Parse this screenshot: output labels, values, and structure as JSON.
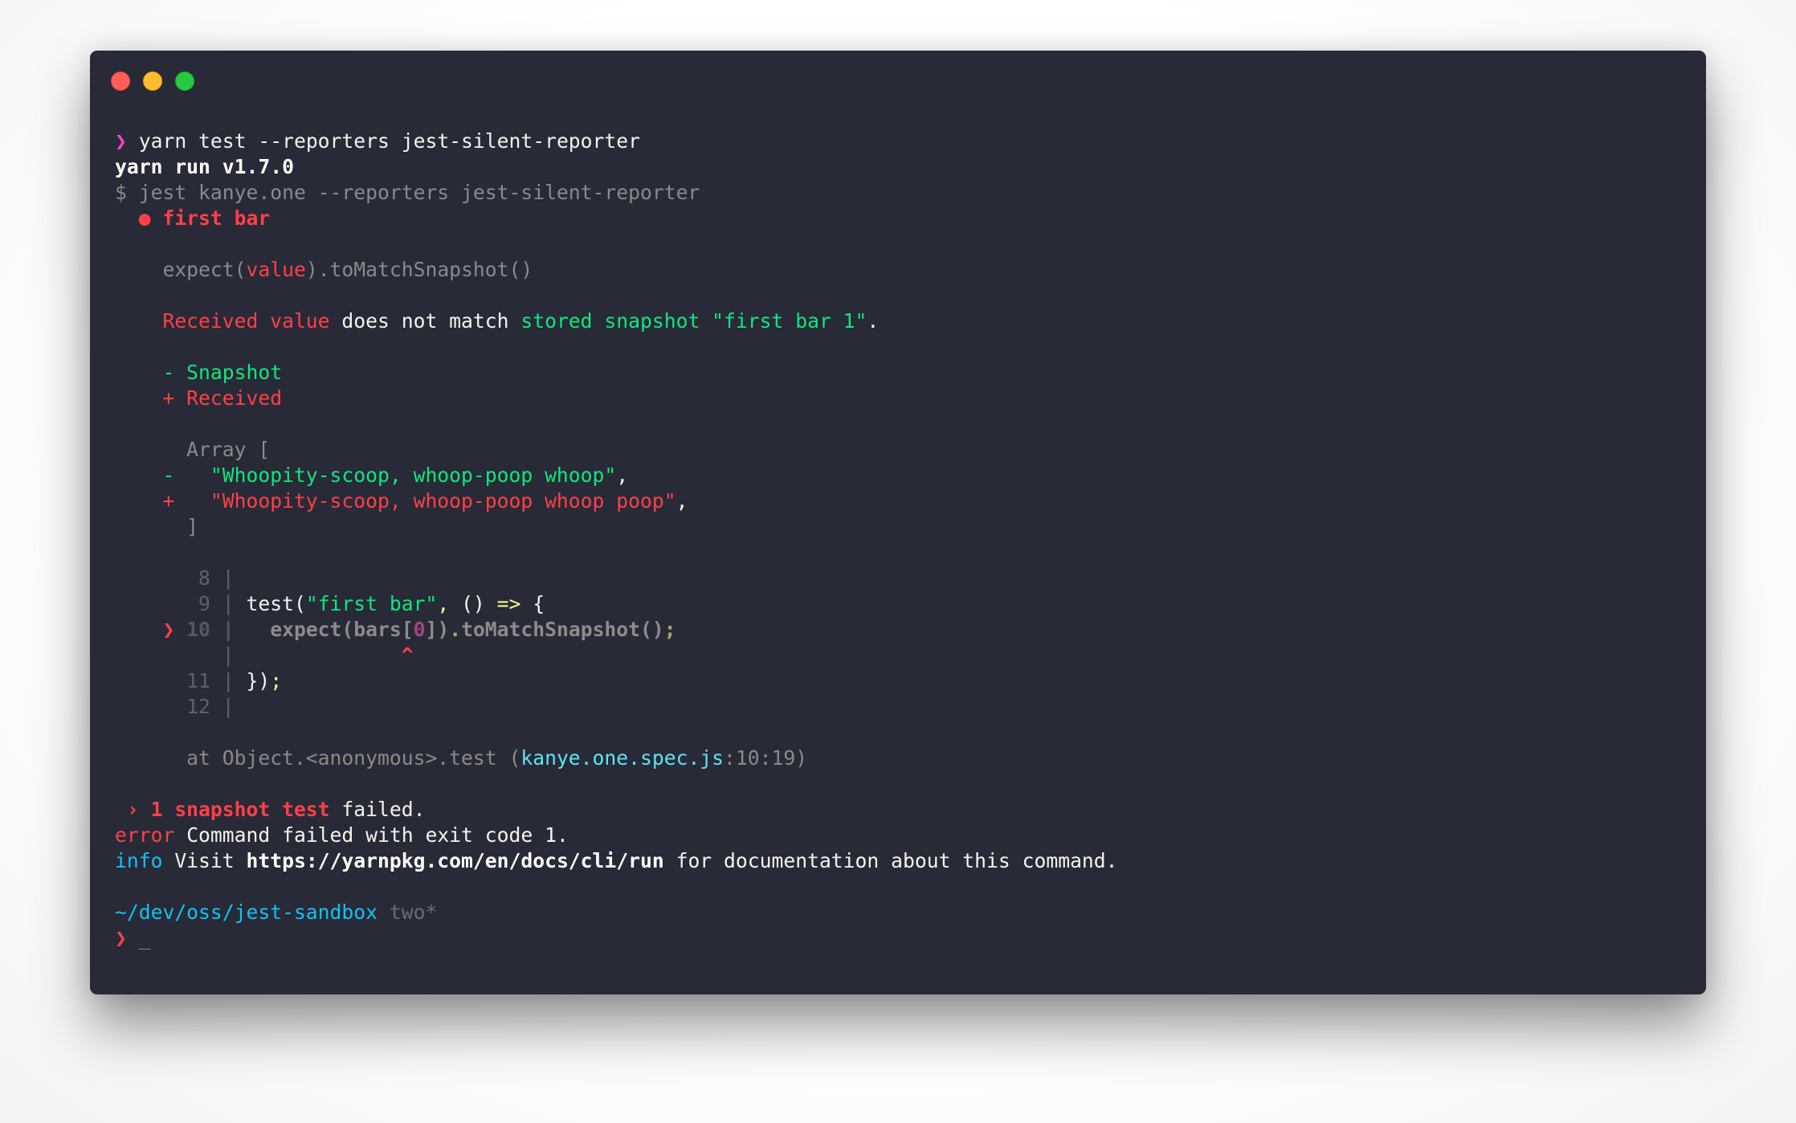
{
  "window": {
    "title": "",
    "traffic_lights": {
      "close_color": "#ff5f57",
      "minimize_color": "#febc2e",
      "maximize_color": "#28c840"
    },
    "background_color": "#282a37"
  },
  "terminal": {
    "lines": [
      {
        "name": "command-line",
        "segments": [
          {
            "text": "❯",
            "cls": "c-pink",
            "name": "prompt-icon"
          },
          {
            "text": " yarn test --reporters jest-silent-reporter",
            "cls": "c-fg",
            "name": "command-text"
          }
        ]
      },
      {
        "name": "yarn-version-line",
        "segments": [
          {
            "text": "yarn run v1.7.0",
            "cls": "c-fgb",
            "name": "yarn-version"
          }
        ]
      },
      {
        "name": "jest-command-line",
        "segments": [
          {
            "text": "$ jest kanye.one --reporters jest-silent-reporter",
            "cls": "c-dim",
            "name": "jest-command"
          }
        ]
      },
      {
        "name": "test-title-line",
        "segments": [
          {
            "text": "  ● first bar",
            "cls": "c-redb",
            "name": "failed-test-title"
          }
        ]
      },
      {
        "name": "blank-line",
        "segments": []
      },
      {
        "name": "matcher-hint-line",
        "segments": [
          {
            "text": "    expect(",
            "cls": "c-dim",
            "name": "matcher-hint"
          },
          {
            "text": "value",
            "cls": "c-red",
            "name": "matcher-hint-received"
          },
          {
            "text": ").toMatchSnapshot()",
            "cls": "c-dim",
            "name": "matcher-hint"
          }
        ]
      },
      {
        "name": "blank-line",
        "segments": []
      },
      {
        "name": "snapshot-message-line",
        "segments": [
          {
            "text": "    Received value",
            "cls": "c-red",
            "name": "received-value-label"
          },
          {
            "text": " does not match ",
            "cls": "c-white",
            "name": "message-text"
          },
          {
            "text": "stored snapshot \"first bar 1\"",
            "cls": "c-green",
            "name": "stored-snapshot-label"
          },
          {
            "text": ".",
            "cls": "c-white",
            "name": "message-text"
          }
        ]
      },
      {
        "name": "blank-line",
        "segments": []
      },
      {
        "name": "diff-legend-snapshot",
        "segments": [
          {
            "text": "    - Snapshot",
            "cls": "c-green",
            "name": "diff-legend-snapshot-label"
          }
        ]
      },
      {
        "name": "diff-legend-received",
        "segments": [
          {
            "text": "    + Received",
            "cls": "c-red",
            "name": "diff-legend-received-label"
          }
        ]
      },
      {
        "name": "blank-line",
        "segments": []
      },
      {
        "name": "diff-array-open",
        "segments": [
          {
            "text": "      Array [",
            "cls": "c-dim",
            "name": "diff-context"
          }
        ]
      },
      {
        "name": "diff-removed-line",
        "segments": [
          {
            "text": "    -   \"Whoopity-scoop, whoop-poop whoop\"",
            "cls": "c-green",
            "name": "diff-removed-value"
          },
          {
            "text": ",",
            "cls": "c-white",
            "name": "diff-punctuation"
          }
        ]
      },
      {
        "name": "diff-added-line",
        "segments": [
          {
            "text": "    +   \"Whoopity-scoop, whoop-poop whoop poop\"",
            "cls": "c-red",
            "name": "diff-added-value"
          },
          {
            "text": ",",
            "cls": "c-white",
            "name": "diff-punctuation"
          }
        ]
      },
      {
        "name": "diff-array-close",
        "segments": [
          {
            "text": "      ]",
            "cls": "c-dim",
            "name": "diff-context"
          }
        ]
      },
      {
        "name": "blank-line",
        "segments": []
      },
      {
        "name": "code-frame-line-8",
        "segments": [
          {
            "text": "       8 |",
            "cls": "c-dark",
            "name": "line-number-gutter"
          }
        ]
      },
      {
        "name": "code-frame-line-9",
        "segments": [
          {
            "text": "       9 |",
            "cls": "c-dark",
            "name": "line-number-gutter"
          },
          {
            "text": " test(",
            "cls": "c-white",
            "name": "code-text"
          },
          {
            "text": "\"first bar\"",
            "cls": "c-green",
            "name": "code-string"
          },
          {
            "text": ",",
            "cls": "c-yellow",
            "name": "code-punctuation"
          },
          {
            "text": " () ",
            "cls": "c-white",
            "name": "code-text"
          },
          {
            "text": "=>",
            "cls": "c-yellow",
            "name": "code-arrow"
          },
          {
            "text": " {",
            "cls": "c-white",
            "name": "code-text"
          }
        ]
      },
      {
        "name": "code-frame-line-10",
        "segments": [
          {
            "text": "    ❯ ",
            "cls": "c-redb",
            "name": "error-line-marker-icon"
          },
          {
            "text": "10 |",
            "cls": "c-darkb",
            "name": "line-number-gutter"
          },
          {
            "text": "   expect(bars[",
            "cls": "c-dimb",
            "name": "code-text"
          },
          {
            "text": "0",
            "cls": "c-purple",
            "name": "code-number"
          },
          {
            "text": "])",
            "cls": "c-dimb",
            "name": "code-text"
          },
          {
            "text": ".",
            "cls": "c-yellowd",
            "name": "code-punctuation"
          },
          {
            "text": "toMatchSnapshot()",
            "cls": "c-dimb",
            "name": "code-text"
          },
          {
            "text": ";",
            "cls": "c-yellowd",
            "name": "code-punctuation"
          }
        ]
      },
      {
        "name": "code-frame-caret-line",
        "segments": [
          {
            "text": "         |",
            "cls": "c-dark",
            "name": "line-number-gutter"
          },
          {
            "text": "              ",
            "cls": "c-white",
            "name": "spacer"
          },
          {
            "text": "^",
            "cls": "c-redb",
            "name": "error-caret"
          }
        ]
      },
      {
        "name": "code-frame-line-11",
        "segments": [
          {
            "text": "      11 |",
            "cls": "c-dark",
            "name": "line-number-gutter"
          },
          {
            "text": " })",
            "cls": "c-white",
            "name": "code-text"
          },
          {
            "text": ";",
            "cls": "c-yellow",
            "name": "code-punctuation"
          }
        ]
      },
      {
        "name": "code-frame-line-12",
        "segments": [
          {
            "text": "      12 |",
            "cls": "c-dark",
            "name": "line-number-gutter"
          }
        ]
      },
      {
        "name": "blank-line",
        "segments": []
      },
      {
        "name": "stack-trace-line",
        "segments": [
          {
            "text": "      at Object.<anonymous>.test (",
            "cls": "c-dim",
            "name": "stack-trace-text"
          },
          {
            "text": "kanye.one.spec.js",
            "cls": "c-cyanl",
            "name": "stack-trace-file-link"
          },
          {
            "text": ":10:19)",
            "cls": "c-dim",
            "name": "stack-trace-location"
          }
        ]
      },
      {
        "name": "blank-line",
        "segments": []
      },
      {
        "name": "summary-line",
        "segments": [
          {
            "text": " › 1 snapshot test",
            "cls": "c-redb",
            "name": "summary-failed-count"
          },
          {
            "text": " failed.",
            "cls": "c-white",
            "name": "summary-text"
          }
        ]
      },
      {
        "name": "yarn-error-line",
        "segments": [
          {
            "text": "error",
            "cls": "c-red",
            "name": "error-label"
          },
          {
            "text": " Command failed with exit code 1.",
            "cls": "c-white",
            "name": "error-message"
          }
        ]
      },
      {
        "name": "yarn-info-line",
        "segments": [
          {
            "text": "info",
            "cls": "c-cyan",
            "name": "info-label"
          },
          {
            "text": " Visit ",
            "cls": "c-white",
            "name": "info-text"
          },
          {
            "text": "https://yarnpkg.com/en/docs/cli/run",
            "cls": "c-fgb",
            "name": "docs-link"
          },
          {
            "text": " for documentation about this command.",
            "cls": "c-white",
            "name": "info-text"
          }
        ]
      },
      {
        "name": "blank-line",
        "segments": []
      },
      {
        "name": "prompt-path-line",
        "segments": [
          {
            "text": "~/dev/oss/jest-sandbox",
            "cls": "c-cyan",
            "name": "current-directory"
          },
          {
            "text": " two*",
            "cls": "c-gray2",
            "name": "git-branch"
          }
        ]
      },
      {
        "name": "prompt-input-line",
        "segments": [
          {
            "text": "❯",
            "cls": "c-redb",
            "name": "prompt-icon"
          },
          {
            "text": " ",
            "cls": "c-white",
            "name": "spacer"
          },
          {
            "text": "_",
            "cls": "c-cursor",
            "name": "cursor"
          }
        ]
      }
    ]
  }
}
